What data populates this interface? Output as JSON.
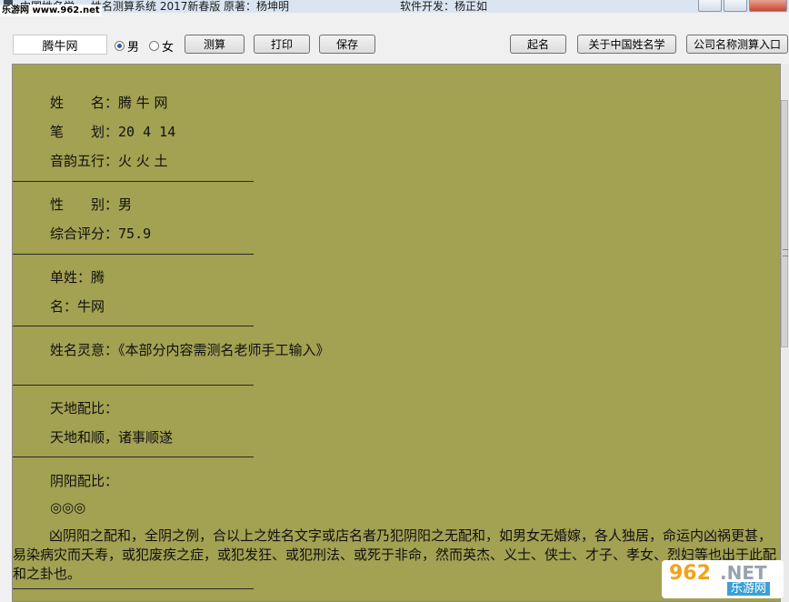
{
  "window": {
    "title_app": "中国姓名学",
    "title_main": "姓名测算系统 2017新春版",
    "author": "原著：杨坤明",
    "developer": "软件开发：杨正如"
  },
  "watermark": {
    "top": "乐游网 www.962.net",
    "logo": "962",
    "net": ".NET",
    "sub": "乐游网"
  },
  "toolbar": {
    "name_value": "腾牛网",
    "radio_male": "男",
    "radio_female": "女",
    "gender_selected": "男",
    "calc_label": "测算",
    "print_label": "打印",
    "save_label": "保存",
    "naming_label": "起名",
    "about_label": "关于中国姓名学",
    "company_label": "公司名称测算入口"
  },
  "result": {
    "name_label": "姓　　名：",
    "name_value": "腾 牛 网",
    "strokes_label": "笔　　划：",
    "strokes_value": "20 4 14",
    "wuxing_label": "音韵五行：",
    "wuxing_value": "火 火 土",
    "gender_label": "性　　别：",
    "gender_value": "男",
    "score_label": "综合评分：",
    "score_value": "75.9",
    "surname_label": "单姓：",
    "surname_value": "腾",
    "given_label": "名：",
    "given_value": "牛网",
    "meaning_label": "姓名灵意：",
    "meaning_value": "《本部分内容需测名老师手工输入》",
    "tiandi_label": "天地配比：",
    "tiandi_value": "天地和顺，诸事顺遂",
    "yinyang_label": "阴阳配比：",
    "yinyang_symbols": "◎◎◎",
    "yinyang_text": "凶阴阳之配和，全阴之例，合以上之姓名文字或店名者乃犯阴阳之无配和，如男女无婚嫁，各人独居，命运内凶祸更甚，易染病灾而夭寿，或犯废疾之症，或犯发狂、或犯刑法、或死于非命，然而英杰、义士、侠士、才子、孝女、烈妇等也出于此配和之卦也。"
  },
  "colors": {
    "content_bg": "#a3a152",
    "window_bg": "#f0f0f0"
  }
}
